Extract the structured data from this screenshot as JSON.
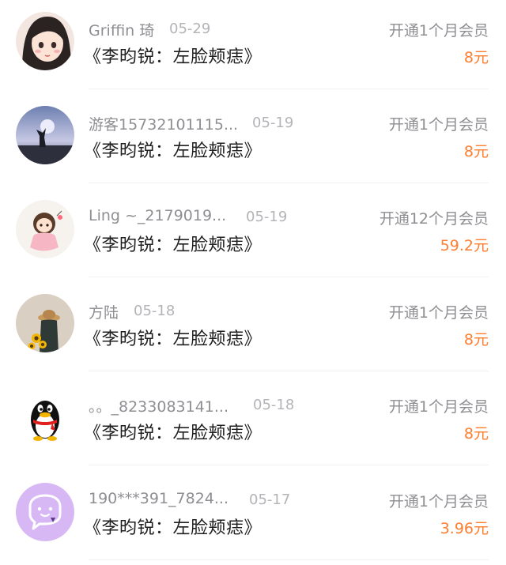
{
  "items": [
    {
      "avatar_icon": "girl-illustration-avatar-icon",
      "name": "Griffin 琦",
      "date": "05-29",
      "title": "《李昀锐：左脸颊痣》",
      "plan": "开通1个月会员",
      "price": "8元"
    },
    {
      "avatar_icon": "sunset-person-photo-avatar-icon",
      "name": "游客15732101115...",
      "date": "05-19",
      "title": "《李昀锐：左脸颊痣》",
      "plan": "开通1个月会员",
      "price": "8元"
    },
    {
      "avatar_icon": "cartoon-girl-avatar-icon",
      "name": "Ling ~_2179019...",
      "date": "05-19",
      "title": "《李昀锐：左脸颊痣》",
      "plan": "开通12个月会员",
      "price": "59.2元"
    },
    {
      "avatar_icon": "sunflower-hat-person-avatar-icon",
      "name": "方陆",
      "date": "05-18",
      "title": "《李昀锐：左脸颊痣》",
      "plan": "开通1个月会员",
      "price": "8元"
    },
    {
      "avatar_icon": "qq-penguin-avatar-icon",
      "name": "。。_8233083141...",
      "date": "05-18",
      "title": "《李昀锐：左脸颊痣》",
      "plan": "开通1个月会员",
      "price": "8元"
    },
    {
      "avatar_icon": "chat-bubble-default-avatar-icon",
      "name": "190***391_7824...",
      "date": "05-17",
      "title": "《李昀锐：左脸颊痣》",
      "plan": "开通1个月会员",
      "price": "3.96元"
    }
  ],
  "colors": {
    "price": "#ff7d2e",
    "muted": "#8e8e93",
    "date": "#b4b4b8",
    "title": "#1f1f1f",
    "default_avatar": "#d7b8f5"
  }
}
